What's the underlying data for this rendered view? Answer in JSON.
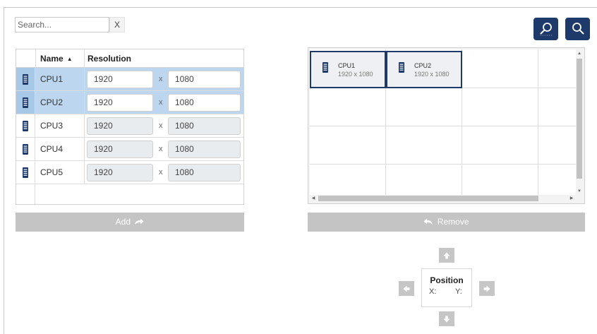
{
  "search": {
    "placeholder": "Search...",
    "clear_label": "X"
  },
  "table": {
    "headers": {
      "name": "Name",
      "resolution": "Resolution"
    },
    "sort_indicator": "▲",
    "separator": "x",
    "rows": [
      {
        "name": "CPU1",
        "width": "1920",
        "height": "1080",
        "selected": true
      },
      {
        "name": "CPU2",
        "width": "1920",
        "height": "1080",
        "selected": true
      },
      {
        "name": "CPU3",
        "width": "1920",
        "height": "1080",
        "selected": false
      },
      {
        "name": "CPU4",
        "width": "1920",
        "height": "1080",
        "selected": false
      },
      {
        "name": "CPU5",
        "width": "1920",
        "height": "1080",
        "selected": false
      }
    ]
  },
  "buttons": {
    "add": "Add",
    "remove": "Remove"
  },
  "grid": {
    "tiles": [
      {
        "name": "CPU1",
        "resolution": "1920 x 1080"
      },
      {
        "name": "CPU2",
        "resolution": "1920 x 1080"
      }
    ]
  },
  "position": {
    "title": "Position",
    "x_label": "X:",
    "y_label": "Y:"
  },
  "colors": {
    "accent": "#1e3a6b",
    "selected_row": "#bcd6ef",
    "button_gray": "#c4c4c4"
  }
}
